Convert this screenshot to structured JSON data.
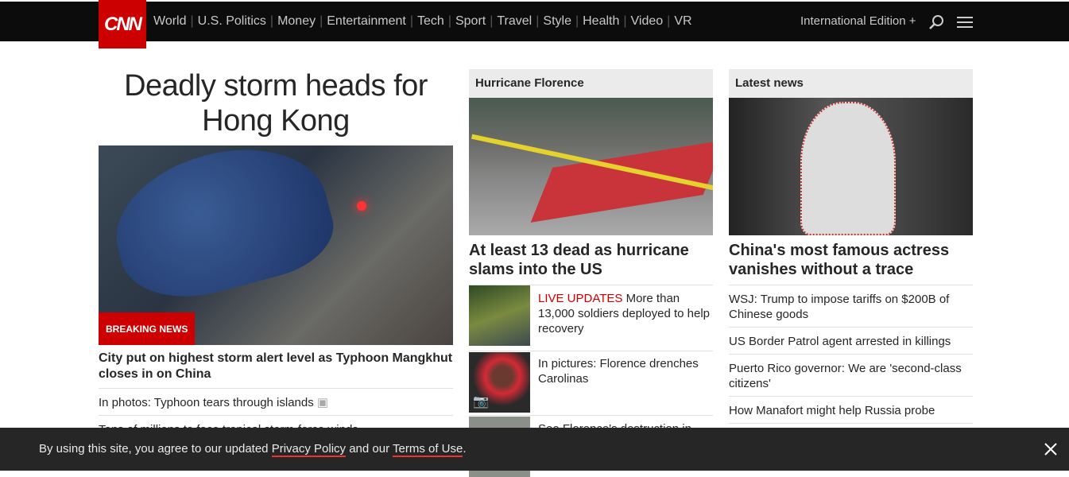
{
  "header": {
    "logo": "CNN",
    "nav": [
      "World",
      "U.S. Politics",
      "Money",
      "Entertainment",
      "Tech",
      "Sport",
      "Travel",
      "Style",
      "Health",
      "Video",
      "VR"
    ],
    "edition": "International Edition +"
  },
  "main": {
    "headline": "Deadly storm heads for Hong Kong",
    "badge": "BREAKING NEWS",
    "hero_title": "City put on highest storm alert level as Typhoon Mangkhut closes in on China",
    "links": [
      "In photos: Typhoon tears through islands",
      "Tens of millions to face tropical storm-force winds"
    ]
  },
  "florence": {
    "section": "Hurricane Florence",
    "title": "At least 13 dead as hurricane slams into the US",
    "items": [
      {
        "tag": "LIVE UPDATES",
        "text": " More than 13,000 soldiers deployed to help recovery"
      },
      {
        "text": "In pictures: Florence drenches Carolinas"
      },
      {
        "text": "See Florence's destruction in"
      }
    ]
  },
  "latest": {
    "section": "Latest news",
    "title": "China's most famous actress vanishes without a trace",
    "links": [
      "WSJ: Trump to impose tariffs on $200B of Chinese goods",
      "US Border Patrol agent arrested in killings",
      "Puerto Rico governor: We are 'second-class citizens'",
      "How Manafort might help Russia probe"
    ]
  },
  "cookie": {
    "prefix": "By using this site, you agree to our updated ",
    "privacy": "Privacy Policy",
    "mid": " and our ",
    "terms": "Terms of Use",
    "suffix": "."
  },
  "colors": {
    "brand": "#cc0000",
    "topbar": "#0c0c0c",
    "banner": "#262626"
  }
}
